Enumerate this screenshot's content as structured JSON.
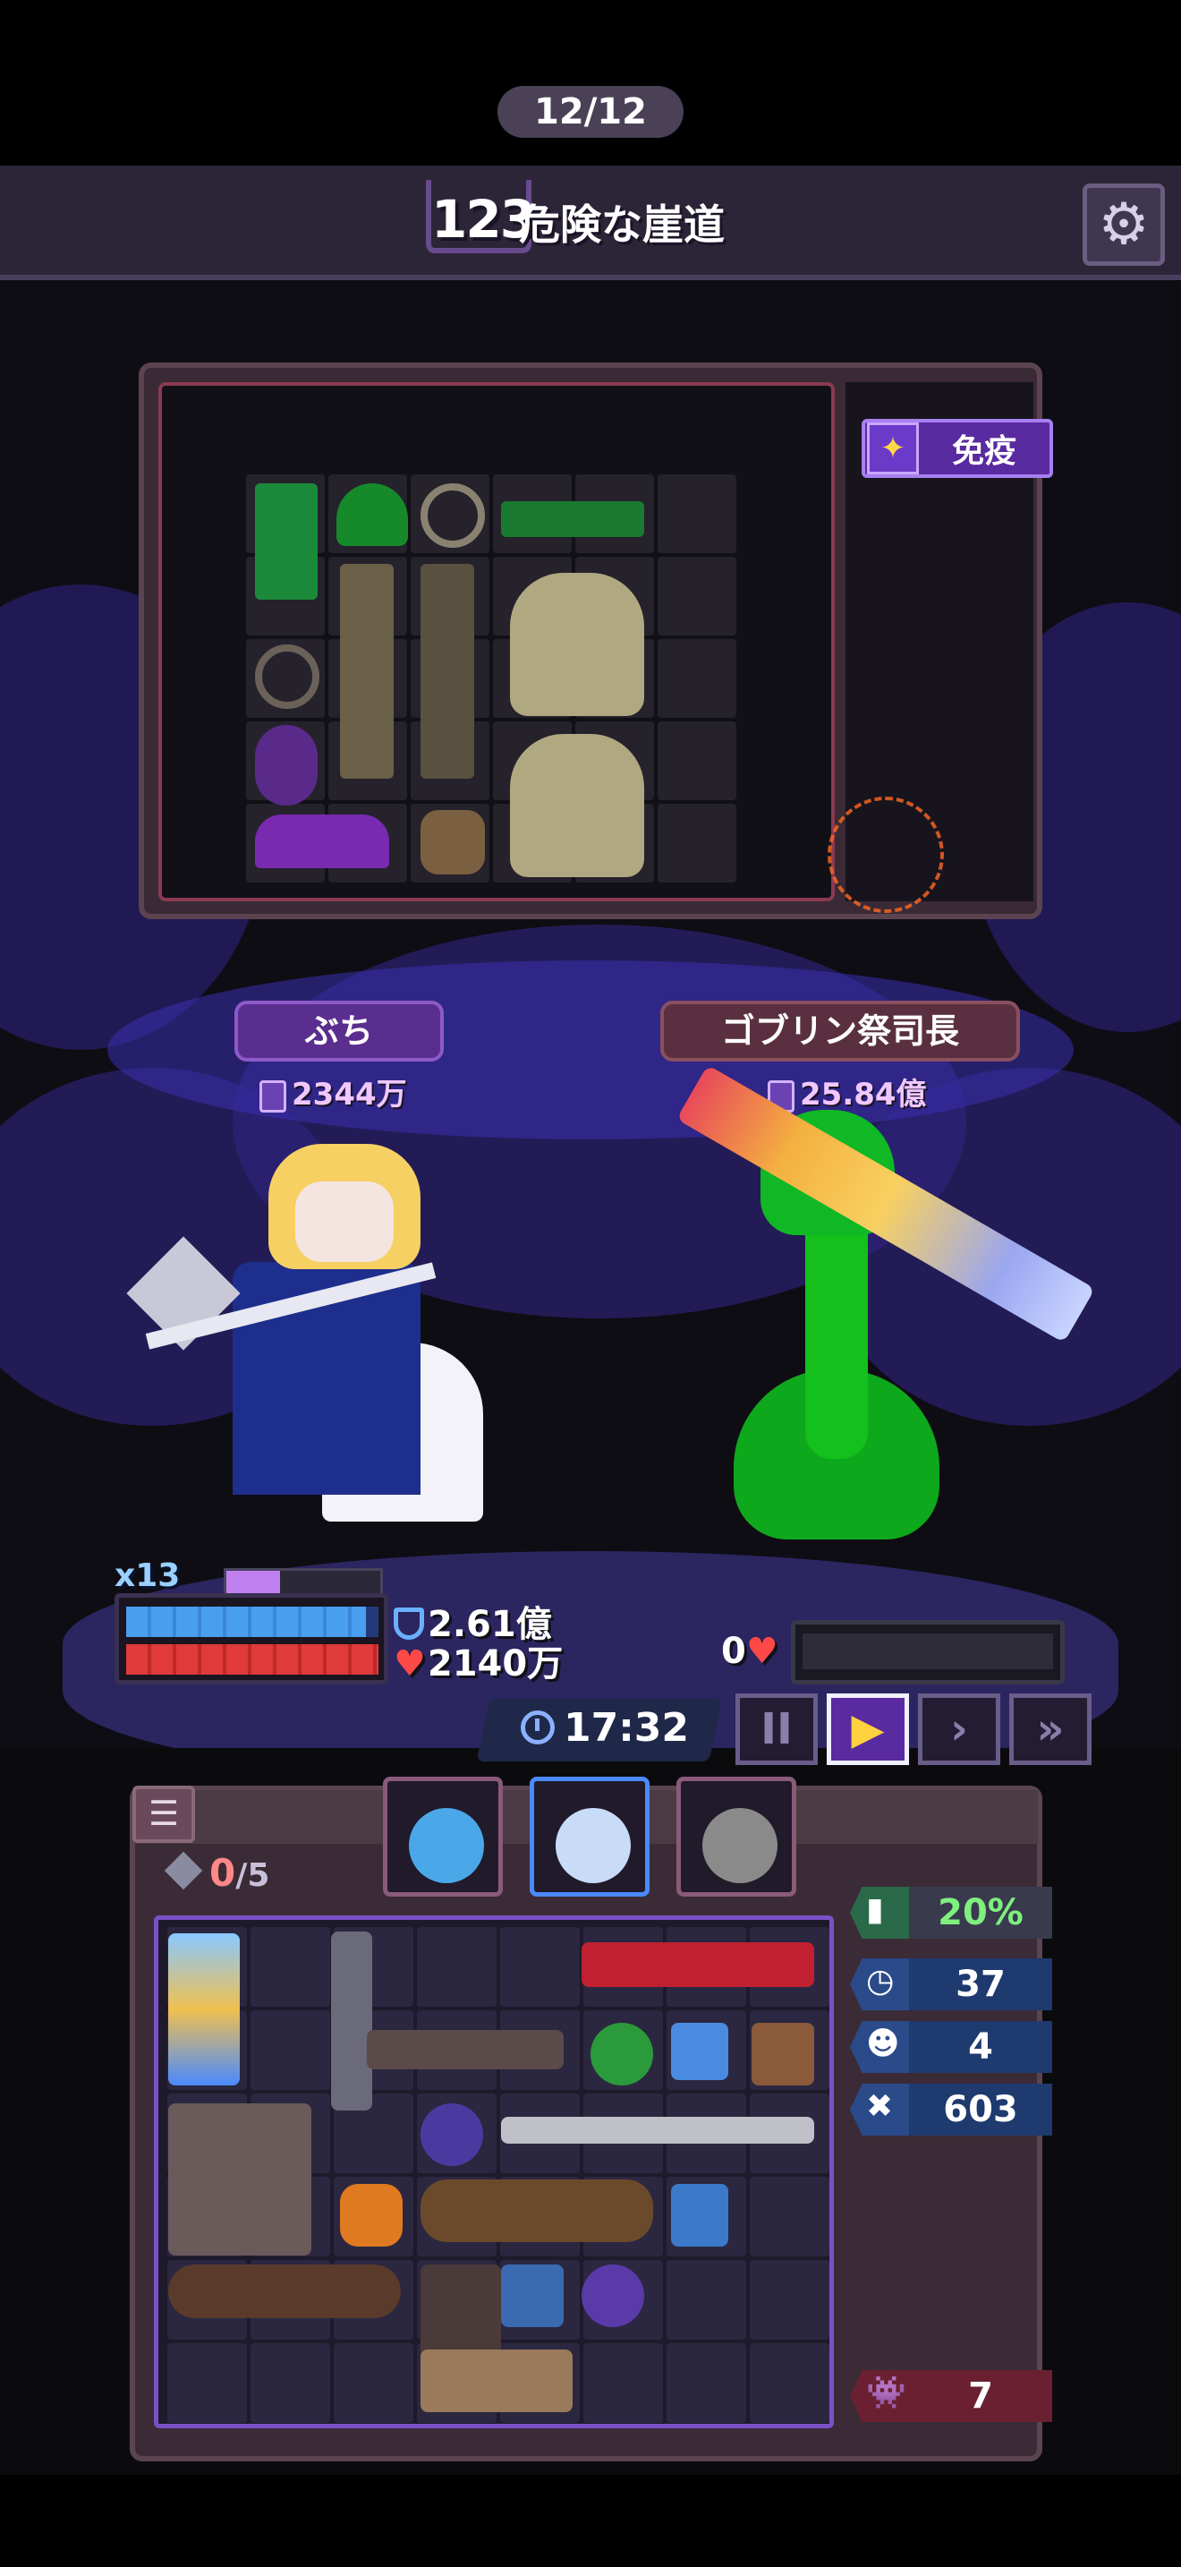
{
  "header": {
    "stage_number": "123",
    "stage_name": "危険な崖道",
    "wave_progress": "12/12"
  },
  "enemy_panel": {
    "status_effect": "免疫"
  },
  "hero": {
    "name": "ぶち",
    "power": "2344万",
    "combo": "x13",
    "shield": "2.61億",
    "hp": "2140万",
    "shield_level": 0.95,
    "hp_level": 1.0,
    "mana_level": 0.35
  },
  "enemy": {
    "name": "ゴブリン祭司長",
    "power": "25.84億",
    "hp": "0"
  },
  "battle": {
    "timer": "17:32",
    "speed_controls": [
      "II",
      "▶",
      "›",
      "»"
    ],
    "active_speed_index": 1
  },
  "inventory": {
    "menu_icon": "list-icon",
    "gem_used": "0",
    "gem_total": "/5",
    "portraits": [
      {
        "name": "blue-slime-portrait",
        "color": "#4aa8e8"
      },
      {
        "name": "white-wolf-portrait",
        "color": "#c8dcf8"
      },
      {
        "name": "ghost-portrait",
        "color": "#8a8a8a"
      }
    ]
  },
  "stats": {
    "crit_rate": "20%",
    "stat_blue_1": "37",
    "stat_blue_2": "4",
    "stat_blue_3": "603",
    "stat_red": "7"
  },
  "colors": {
    "accent": "#7a50c8",
    "shield": "#4a9ef0",
    "hp": "#e03a3a",
    "crit_text": "#7ef07e"
  }
}
